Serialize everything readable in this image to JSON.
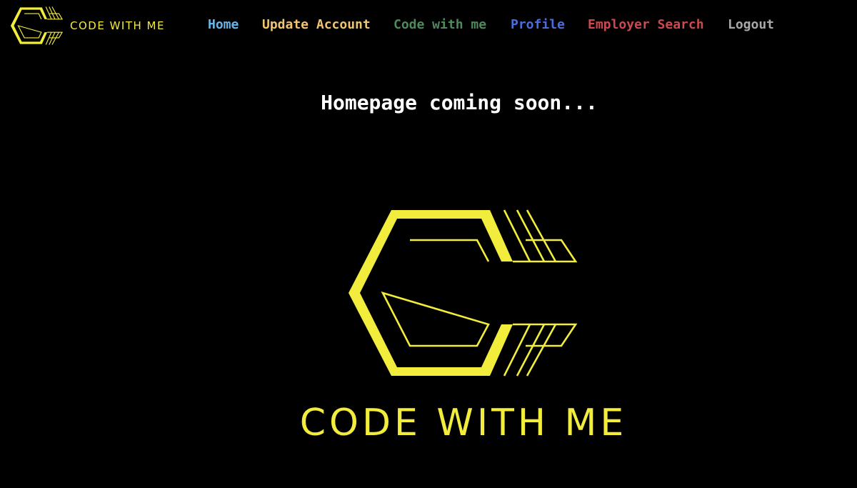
{
  "brand": {
    "name": "CODE WITH ME",
    "logo_color": "#f2ec3d"
  },
  "nav": {
    "items": [
      {
        "label": "Home",
        "color": "#67b6ea"
      },
      {
        "label": "Update Account",
        "color": "#f0c472"
      },
      {
        "label": "Code with me",
        "color": "#4e8a5a"
      },
      {
        "label": "Profile",
        "color": "#4a6de0"
      },
      {
        "label": "Employer Search",
        "color": "#cc4a4e"
      },
      {
        "label": "Logout",
        "color": "#a9a9a9"
      }
    ]
  },
  "main": {
    "headline": "Homepage coming soon...",
    "hero_text": "CODE WITH ME"
  }
}
